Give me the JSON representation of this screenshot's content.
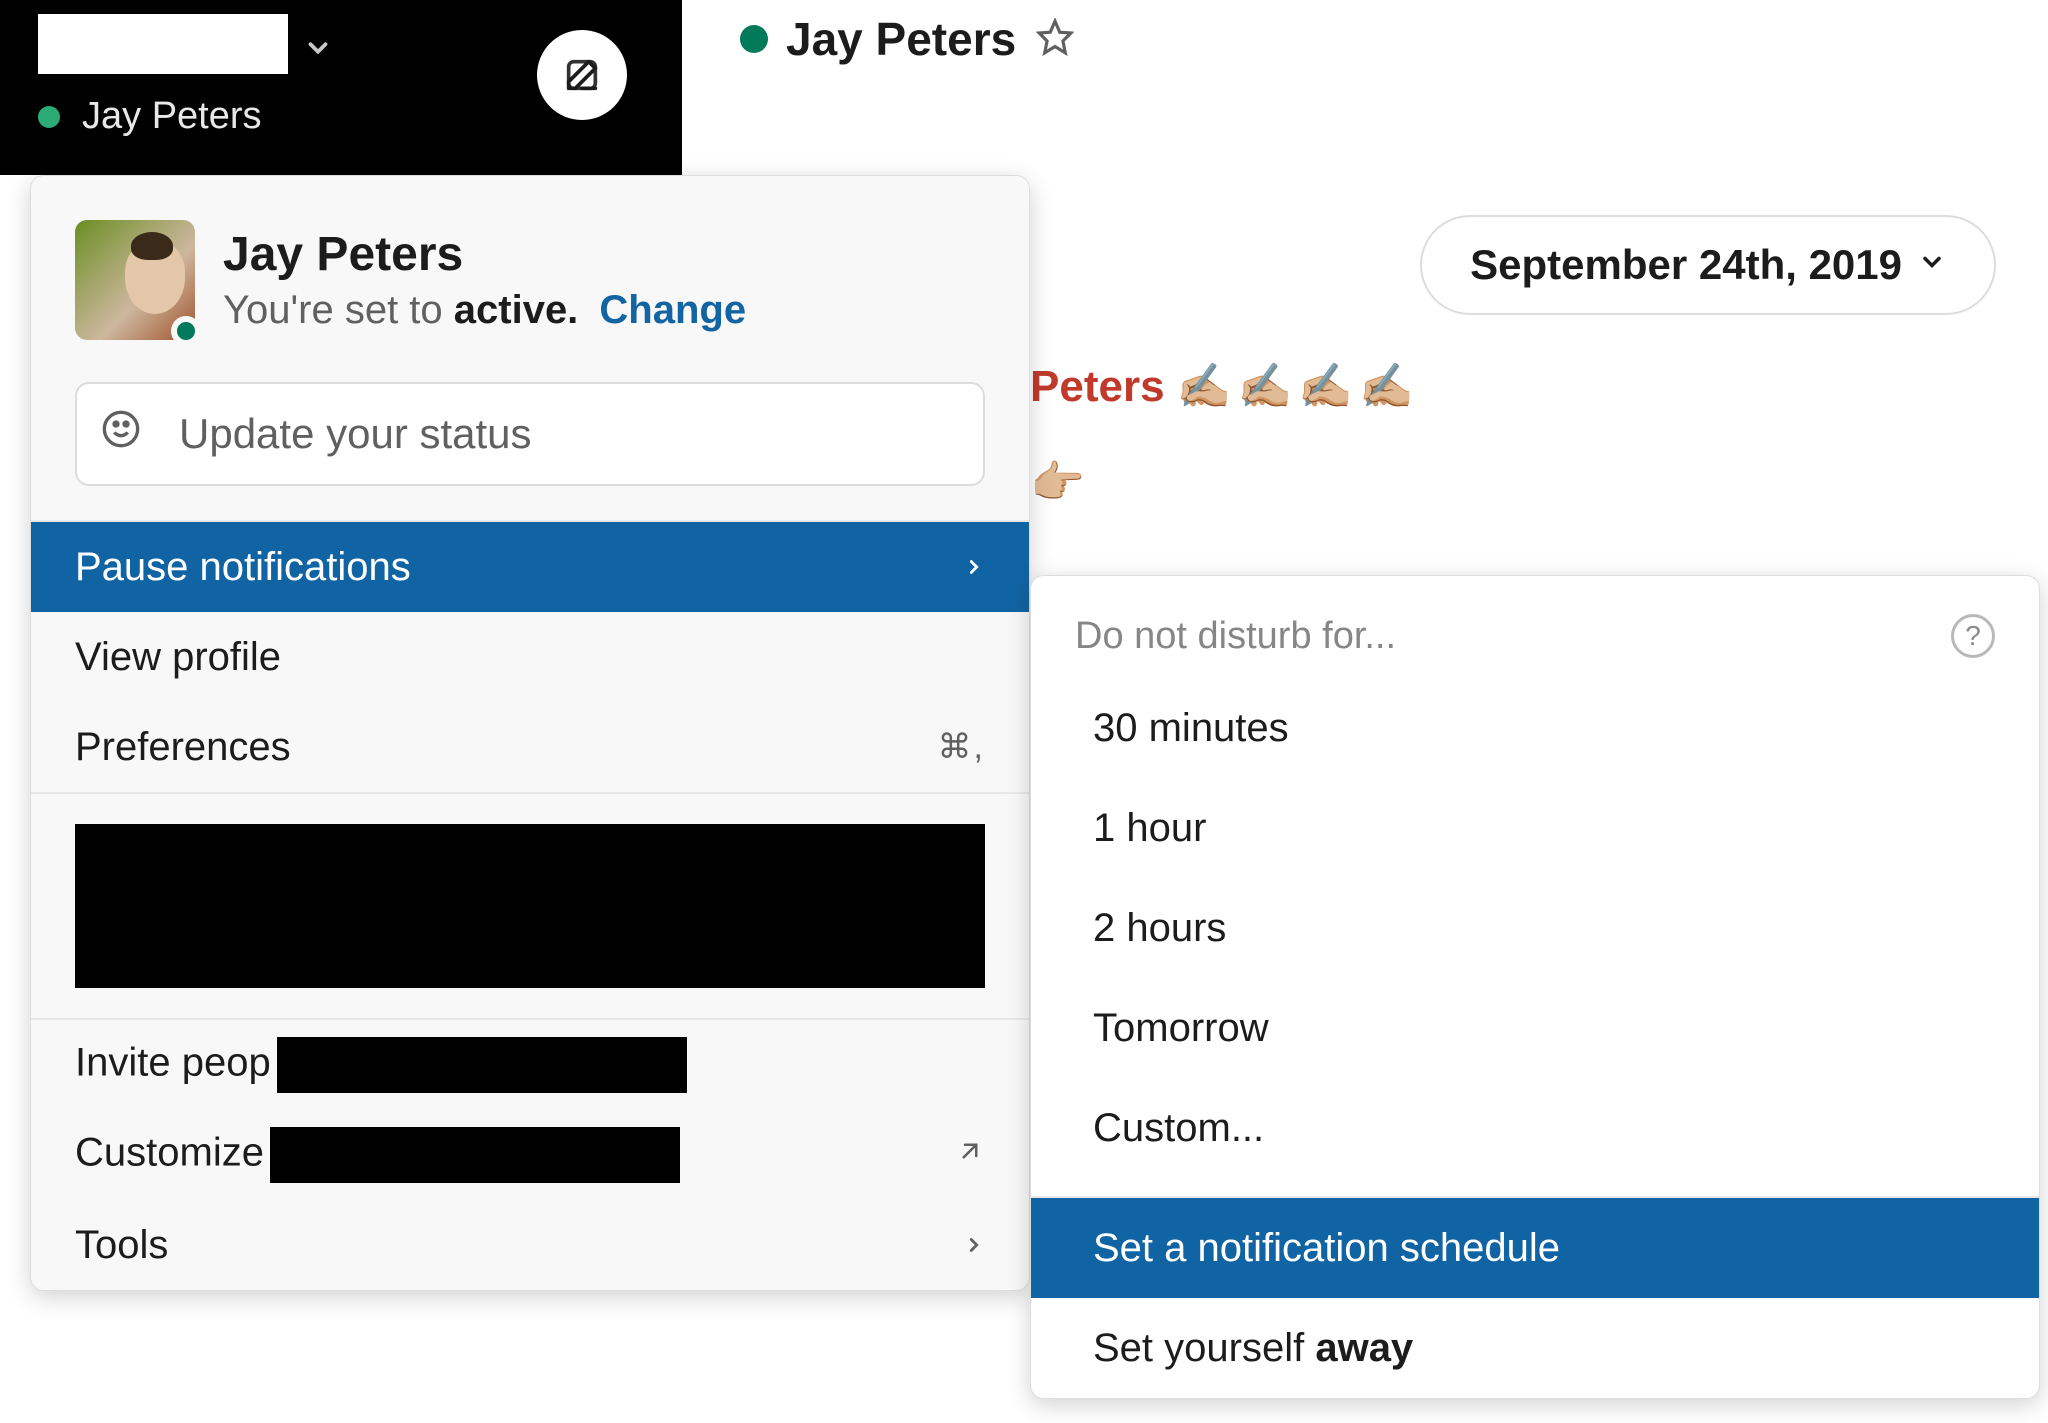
{
  "sidebar": {
    "user_name": "Jay Peters"
  },
  "channel_header": {
    "name": "Jay Peters"
  },
  "date_pill": "September 24th, 2019",
  "status_line": {
    "name_fragment": "Peters",
    "emoji_sequence": "✍🏼✍🏼✍🏼✍🏼",
    "below_emoji": "👉🏼"
  },
  "user_menu": {
    "name": "Jay Peters",
    "status_prefix": "You're set to ",
    "status_word": "active.",
    "change_label": "Change",
    "status_placeholder": "Update your status",
    "items": {
      "pause": "Pause notifications",
      "view_profile": "View profile",
      "preferences": "Preferences",
      "preferences_shortcut": "⌘,",
      "invite": "Invite peop",
      "customize": "Customize",
      "tools": "Tools"
    }
  },
  "submenu": {
    "header": "Do not disturb for...",
    "opt1": "30 minutes",
    "opt2": "1 hour",
    "opt3": "2 hours",
    "opt4": "Tomorrow",
    "opt5": "Custom...",
    "schedule": "Set a notification schedule",
    "away_prefix": "Set yourself ",
    "away_word": "away"
  }
}
